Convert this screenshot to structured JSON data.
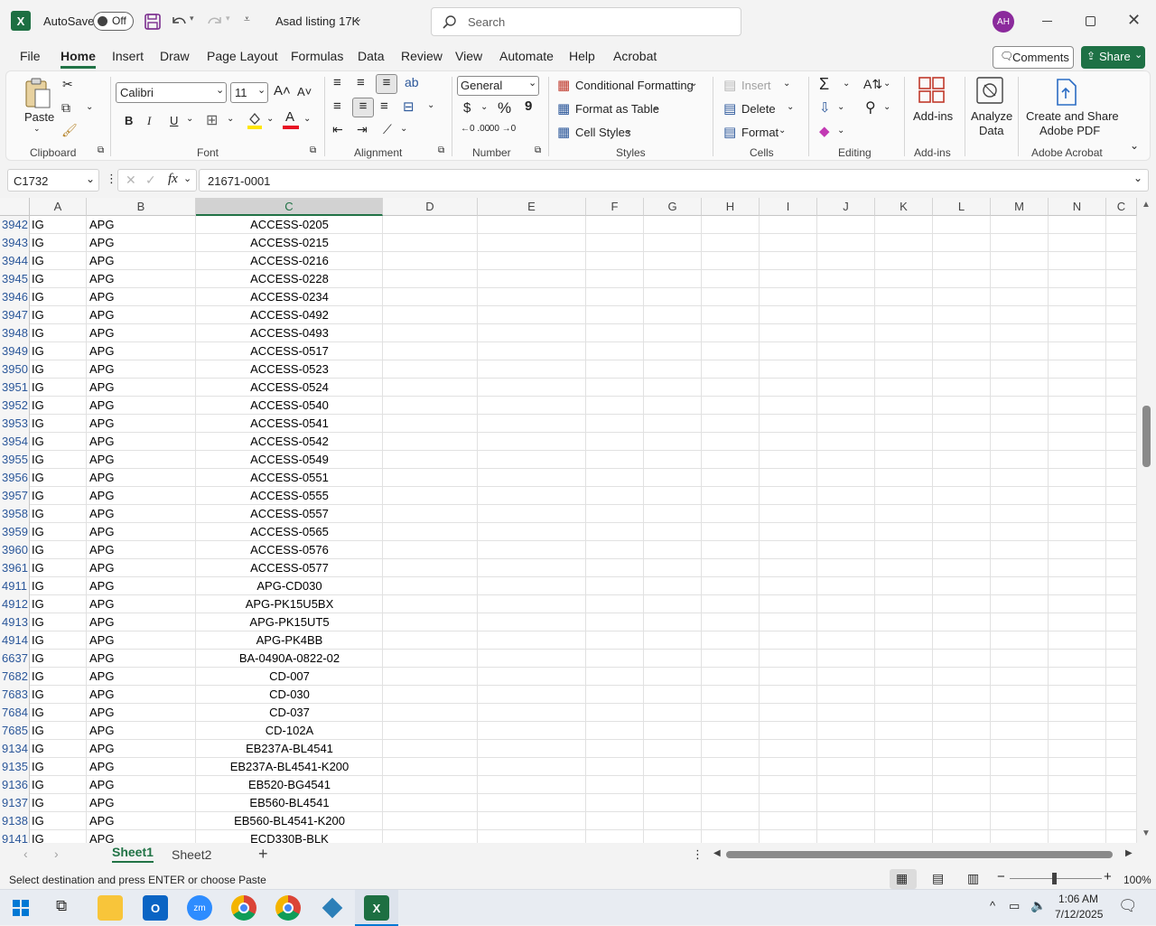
{
  "titlebar": {
    "autosave_label": "AutoSave",
    "autosave_state": "Off",
    "filename": "Asad listing 17K",
    "search_placeholder": "Search",
    "avatar_initials": "AH"
  },
  "menu": [
    "File",
    "Home",
    "Insert",
    "Draw",
    "Page Layout",
    "Formulas",
    "Data",
    "Review",
    "View",
    "Automate",
    "Help",
    "Acrobat"
  ],
  "menu_active": "Home",
  "menu_right": {
    "comments": "Comments",
    "share": "Share"
  },
  "ribbon": {
    "clipboard": {
      "paste": "Paste",
      "label": "Clipboard"
    },
    "font": {
      "name": "Calibri",
      "size": "11",
      "label": "Font",
      "bold": "B",
      "italic": "I",
      "underline": "U"
    },
    "alignment": {
      "label": "Alignment"
    },
    "number": {
      "format": "General",
      "label": "Number",
      "currency": "$",
      "percent": "%",
      "comma": "9"
    },
    "styles": {
      "conditional": "Conditional Formatting",
      "table": "Format as Table",
      "cell": "Cell Styles",
      "label": "Styles"
    },
    "cells": {
      "insert": "Insert",
      "delete": "Delete",
      "format": "Format",
      "label": "Cells"
    },
    "editing": {
      "label": "Editing"
    },
    "addins": {
      "addins": "Add-ins",
      "label": "Add-ins"
    },
    "analyze": {
      "line1": "Analyze",
      "line2": "Data"
    },
    "acrobat": {
      "line1": "Create and Share",
      "line2": "Adobe PDF",
      "label": "Adobe Acrobat"
    }
  },
  "formula": {
    "namebox": "C1732",
    "fx": "fx",
    "value": "21671-0001"
  },
  "columns": [
    "A",
    "B",
    "C",
    "D",
    "E",
    "F",
    "G",
    "H",
    "I",
    "J",
    "K",
    "L",
    "M",
    "N",
    "C"
  ],
  "rows": [
    {
      "n": "3942",
      "a": "IG",
      "b": "APG",
      "c": "ACCESS-0205"
    },
    {
      "n": "3943",
      "a": "IG",
      "b": "APG",
      "c": "ACCESS-0215"
    },
    {
      "n": "3944",
      "a": "IG",
      "b": "APG",
      "c": "ACCESS-0216"
    },
    {
      "n": "3945",
      "a": "IG",
      "b": "APG",
      "c": "ACCESS-0228"
    },
    {
      "n": "3946",
      "a": "IG",
      "b": "APG",
      "c": "ACCESS-0234"
    },
    {
      "n": "3947",
      "a": "IG",
      "b": "APG",
      "c": "ACCESS-0492"
    },
    {
      "n": "3948",
      "a": "IG",
      "b": "APG",
      "c": "ACCESS-0493"
    },
    {
      "n": "3949",
      "a": "IG",
      "b": "APG",
      "c": "ACCESS-0517"
    },
    {
      "n": "3950",
      "a": "IG",
      "b": "APG",
      "c": "ACCESS-0523"
    },
    {
      "n": "3951",
      "a": "IG",
      "b": "APG",
      "c": "ACCESS-0524"
    },
    {
      "n": "3952",
      "a": "IG",
      "b": "APG",
      "c": "ACCESS-0540"
    },
    {
      "n": "3953",
      "a": "IG",
      "b": "APG",
      "c": "ACCESS-0541"
    },
    {
      "n": "3954",
      "a": "IG",
      "b": "APG",
      "c": "ACCESS-0542"
    },
    {
      "n": "3955",
      "a": "IG",
      "b": "APG",
      "c": "ACCESS-0549"
    },
    {
      "n": "3956",
      "a": "IG",
      "b": "APG",
      "c": "ACCESS-0551"
    },
    {
      "n": "3957",
      "a": "IG",
      "b": "APG",
      "c": "ACCESS-0555"
    },
    {
      "n": "3958",
      "a": "IG",
      "b": "APG",
      "c": "ACCESS-0557"
    },
    {
      "n": "3959",
      "a": "IG",
      "b": "APG",
      "c": "ACCESS-0565"
    },
    {
      "n": "3960",
      "a": "IG",
      "b": "APG",
      "c": "ACCESS-0576"
    },
    {
      "n": "3961",
      "a": "IG",
      "b": "APG",
      "c": "ACCESS-0577"
    },
    {
      "n": "4911",
      "a": "IG",
      "b": "APG",
      "c": "APG-CD030"
    },
    {
      "n": "4912",
      "a": "IG",
      "b": "APG",
      "c": "APG-PK15U5BX"
    },
    {
      "n": "4913",
      "a": "IG",
      "b": "APG",
      "c": "APG-PK15UT5"
    },
    {
      "n": "4914",
      "a": "IG",
      "b": "APG",
      "c": "APG-PK4BB"
    },
    {
      "n": "6637",
      "a": "IG",
      "b": "APG",
      "c": "BA-0490A-0822-02"
    },
    {
      "n": "7682",
      "a": "IG",
      "b": "APG",
      "c": "CD-007"
    },
    {
      "n": "7683",
      "a": "IG",
      "b": "APG",
      "c": "CD-030"
    },
    {
      "n": "7684",
      "a": "IG",
      "b": "APG",
      "c": "CD-037"
    },
    {
      "n": "7685",
      "a": "IG",
      "b": "APG",
      "c": "CD-102A"
    },
    {
      "n": "9134",
      "a": "IG",
      "b": "APG",
      "c": "EB237A-BL4541"
    },
    {
      "n": "9135",
      "a": "IG",
      "b": "APG",
      "c": "EB237A-BL4541-K200"
    },
    {
      "n": "9136",
      "a": "IG",
      "b": "APG",
      "c": "EB520-BG4541"
    },
    {
      "n": "9137",
      "a": "IG",
      "b": "APG",
      "c": "EB560-BL4541"
    },
    {
      "n": "9138",
      "a": "IG",
      "b": "APG",
      "c": "EB560-BL4541-K200"
    },
    {
      "n": "9141",
      "a": "IG",
      "b": "APG",
      "c": "ECD330B-BLK"
    }
  ],
  "sheets": [
    "Sheet1",
    "Sheet2"
  ],
  "status": {
    "message": "Select destination and press ENTER or choose Paste",
    "zoom": "100%"
  },
  "taskbar": {
    "time": "1:06 AM",
    "date": "7/12/2025"
  },
  "colors": {
    "excel_green": "#217346",
    "share_green": "#1e7145",
    "avatar_purple": "#8b2a9c"
  }
}
